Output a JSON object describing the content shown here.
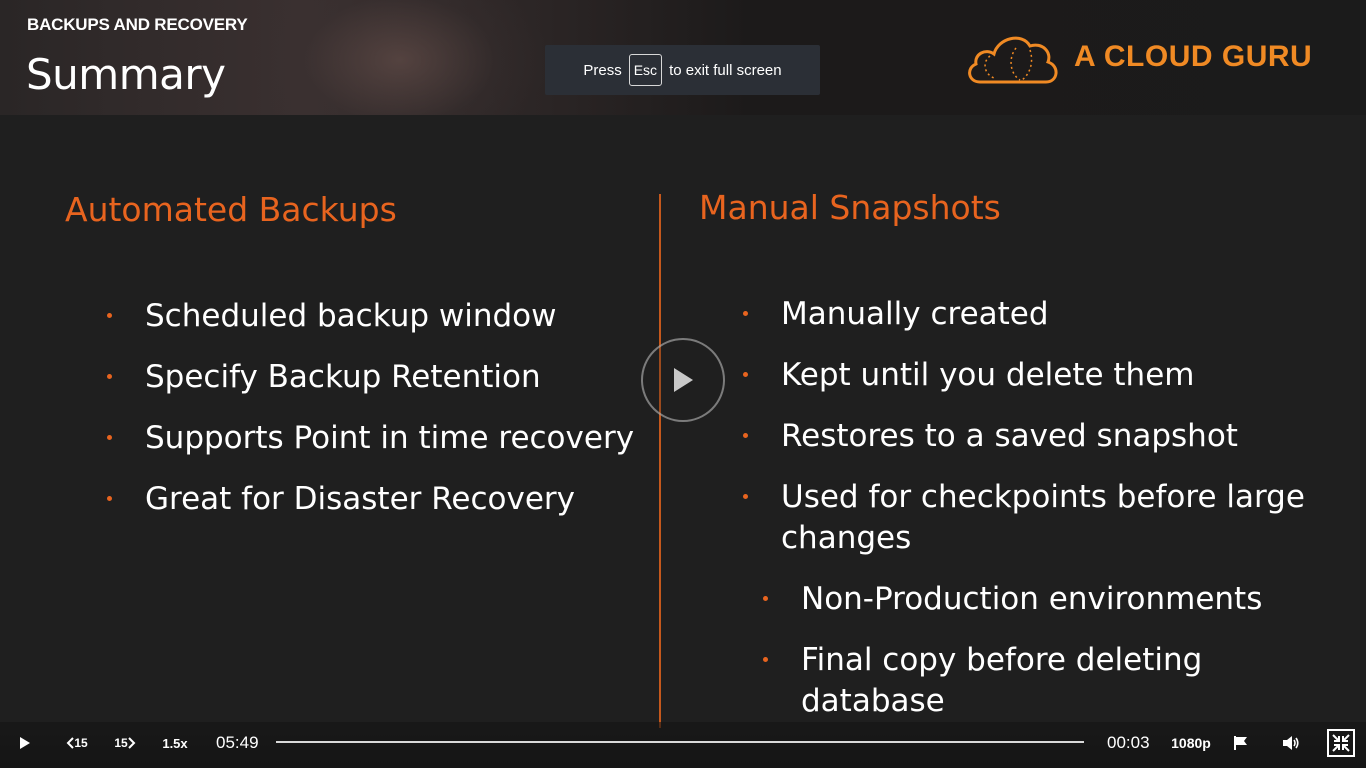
{
  "header": {
    "course_label": "BACKUPS AND RECOVERY",
    "title": "Summary",
    "logo_text": "A CLOUD GURU"
  },
  "toast": {
    "prefix": "Press",
    "key": "Esc",
    "suffix": "to exit full screen"
  },
  "slide": {
    "left": {
      "heading": "Automated Backups",
      "items": [
        "Scheduled backup window",
        "Specify Backup Retention",
        "Supports Point in time recovery",
        "Great for Disaster Recovery"
      ]
    },
    "right": {
      "heading": "Manual Snapshots",
      "items": [
        "Manually created",
        "Kept until you delete them",
        "Restores to a saved snapshot",
        "Used for checkpoints before large changes"
      ],
      "subitems": [
        "Non-Production environments",
        "Final copy before deleting database"
      ]
    }
  },
  "player": {
    "skip_back_label": "15",
    "skip_forward_label": "15",
    "speed": "1.5x",
    "remaining_time": "05:49",
    "current_time": "00:03",
    "quality": "1080p",
    "accent_color": "#e8641f",
    "icons": [
      "play-icon",
      "skip-back-icon",
      "skip-forward-icon",
      "flag-icon",
      "volume-icon",
      "exit-fullscreen-icon"
    ]
  }
}
